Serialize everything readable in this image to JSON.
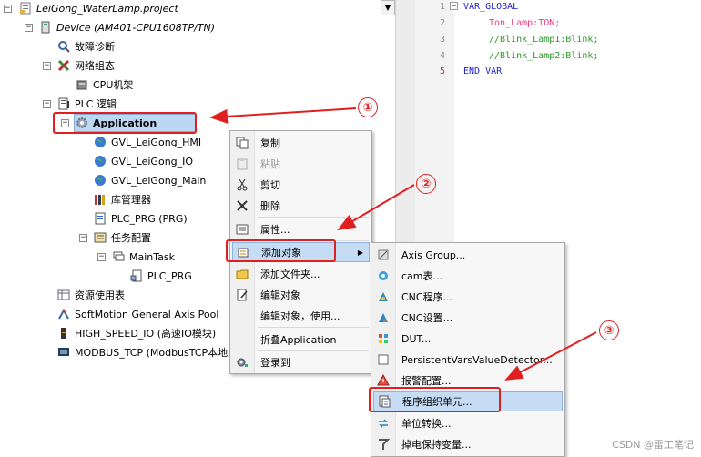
{
  "tree": {
    "project": "LeiGong_WaterLamp.project",
    "device": "Device (AM401-CPU1608TP/TN)",
    "diagnosis": "故障诊断",
    "network": "网络组态",
    "cpu_rack": "CPU机架",
    "plc_logic": "PLC 逻辑",
    "application": "Application",
    "gvl_hmi": "GVL_LeiGong_HMI",
    "gvl_io": "GVL_LeiGong_IO",
    "gvl_main": "GVL_LeiGong_Main",
    "library": "库管理器",
    "plc_prg": "PLC_PRG (PRG)",
    "task_config": "任务配置",
    "main_task": "MainTask",
    "plc_prg_task": "PLC_PRG",
    "resource": "资源使用表",
    "softmotion": "SoftMotion General Axis Pool",
    "high_speed_io": "HIGH_SPEED_IO (高速IO模块)",
    "modbus": "MODBUS_TCP (ModbusTCP本地从站)"
  },
  "editor": {
    "lines": [
      {
        "num": "1",
        "text": "VAR_GLOBAL"
      },
      {
        "num": "2",
        "name": "Ton_Lamp",
        "type": "TON",
        "sep": ":",
        "end": ";"
      },
      {
        "num": "3",
        "text": "//Blink_Lamp1:Blink;"
      },
      {
        "num": "4",
        "text": "//Blink_Lamp2:Blink;"
      },
      {
        "num": "5",
        "text": "END_VAR"
      }
    ]
  },
  "menu1": {
    "items": [
      {
        "label": "复制",
        "icon": "copy-icon",
        "enabled": true
      },
      {
        "label": "粘贴",
        "icon": "paste-icon",
        "enabled": false
      },
      {
        "label": "剪切",
        "icon": "cut-icon",
        "enabled": true
      },
      {
        "label": "删除",
        "icon": "delete-icon",
        "enabled": true
      },
      {
        "label": "属性...",
        "icon": "properties-icon",
        "enabled": true
      },
      {
        "label": "添加对象",
        "icon": "add-object-icon",
        "enabled": true
      },
      {
        "label": "添加文件夹...",
        "icon": "folder-icon",
        "enabled": true
      },
      {
        "label": "编辑对象",
        "icon": "edit-object-icon",
        "enabled": true
      },
      {
        "label": "编辑对象，使用...",
        "icon": "",
        "enabled": true
      },
      {
        "label": "折叠Application",
        "icon": "",
        "enabled": true
      },
      {
        "label": "登录到",
        "icon": "login-icon",
        "enabled": true
      }
    ]
  },
  "menu2": {
    "items": [
      {
        "label": "Axis Group...",
        "icon": "axis-group-icon"
      },
      {
        "label": "cam表...",
        "icon": "cam-table-icon"
      },
      {
        "label": "CNC程序...",
        "icon": "cnc-program-icon"
      },
      {
        "label": "CNC设置...",
        "icon": "cnc-settings-icon"
      },
      {
        "label": "DUT...",
        "icon": "dut-icon"
      },
      {
        "label": "PersistentVarsValueDetector...",
        "icon": "persistent-icon"
      },
      {
        "label": "报警配置...",
        "icon": "alarm-icon"
      },
      {
        "label": "程序组织单元...",
        "icon": "pou-icon"
      },
      {
        "label": "单位转换...",
        "icon": "unit-convert-icon"
      },
      {
        "label": "掉电保持变量...",
        "icon": "retain-icon"
      }
    ]
  },
  "annotations": [
    "①",
    "②",
    "③"
  ],
  "watermark": "CSDN @雷工笔记",
  "colors": {
    "annotation_red": "#e02020",
    "selection_blue": "#bcd7f1",
    "keyword_blue": "#1f1fce",
    "comment_green": "#2a9a2a",
    "type_pink": "#ef3b7f"
  }
}
